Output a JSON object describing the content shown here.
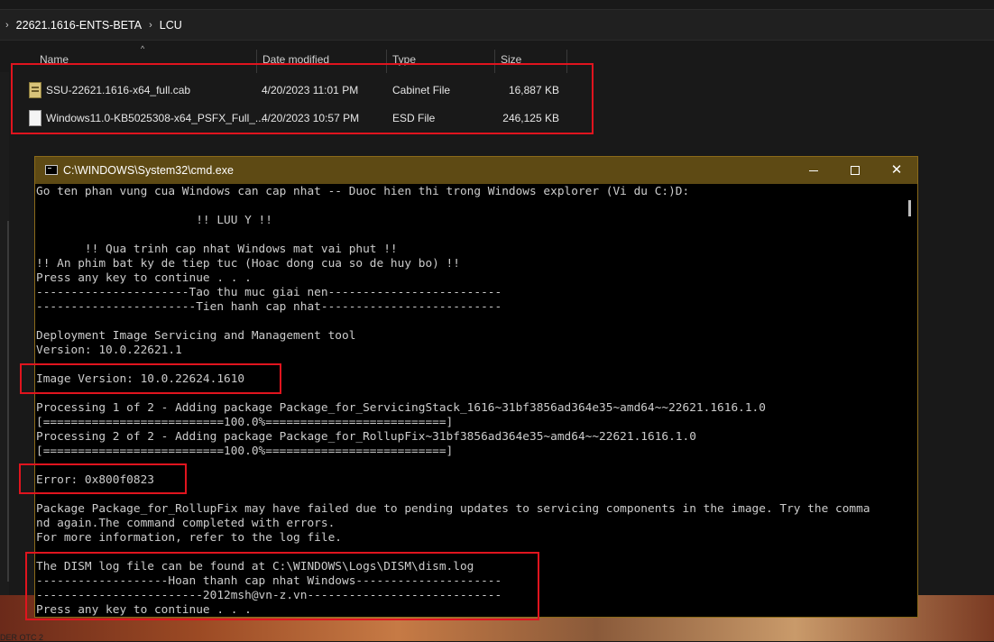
{
  "explorer": {
    "breadcrumb": [
      "22621.1616-ENTS-BETA",
      "LCU"
    ],
    "columns": {
      "name": "Name",
      "date": "Date modified",
      "type": "Type",
      "size": "Size"
    },
    "files": [
      {
        "name": "SSU-22621.1616-x64_full.cab",
        "date": "4/20/2023 11:01 PM",
        "type": "Cabinet File",
        "size": "16,887 KB",
        "icon": "cabinet-file-icon"
      },
      {
        "name": "Windows11.0-KB5025308-x64_PSFX_Full_...",
        "date": "4/20/2023 10:57 PM",
        "type": "ESD File",
        "size": "246,125 KB",
        "icon": "document-file-icon"
      }
    ]
  },
  "cmd": {
    "title": "C:\\WINDOWS\\System32\\cmd.exe",
    "close_glyph": "✕",
    "lines": [
      "Go ten phan vung cua Windows can cap nhat -- Duoc hien thi trong Windows explorer (Vi du C:)D:",
      "",
      "                       !! LUU Y !!",
      "",
      "       !! Qua trinh cap nhat Windows mat vai phut !!",
      "!! An phim bat ky de tiep tuc (Hoac dong cua so de huy bo) !!",
      "Press any key to continue . . .",
      "----------------------Tao thu muc giai nen-------------------------",
      "-----------------------Tien hanh cap nhat--------------------------",
      "",
      "Deployment Image Servicing and Management tool",
      "Version: 10.0.22621.1",
      "",
      "Image Version: 10.0.22624.1610",
      "",
      "Processing 1 of 2 - Adding package Package_for_ServicingStack_1616~31bf3856ad364e35~amd64~~22621.1616.1.0",
      "[==========================100.0%==========================]",
      "Processing 2 of 2 - Adding package Package_for_RollupFix~31bf3856ad364e35~amd64~~22621.1616.1.0",
      "[==========================100.0%==========================]",
      "",
      "Error: 0x800f0823",
      "",
      "Package Package_for_RollupFix may have failed due to pending updates to servicing components in the image. Try the comma",
      "nd again.The command completed with errors.",
      "For more information, refer to the log file.",
      "",
      "The DISM log file can be found at C:\\WINDOWS\\Logs\\DISM\\dism.log",
      "-------------------Hoan thanh cap nhat Windows---------------------",
      "------------------------2012msh@vn-z.vn----------------------------",
      "Press any key to continue . . ."
    ]
  },
  "taskbar": {
    "label": "DER OTC 2"
  },
  "colors": {
    "highlight": "#e0141e",
    "cmd_titlebar": "#5e4a14",
    "console_text": "#cccccc"
  }
}
